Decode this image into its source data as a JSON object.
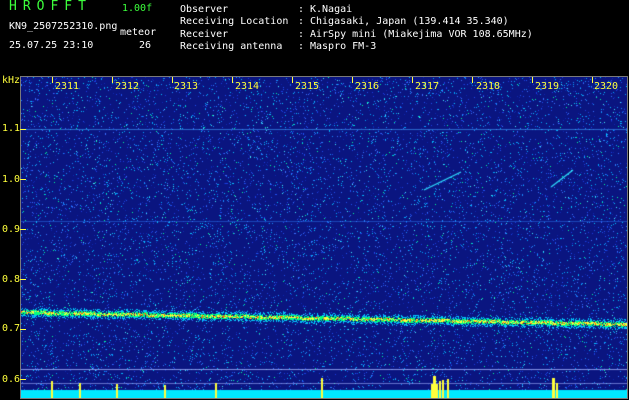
{
  "header": {
    "app_title": "HROFFT",
    "version": "1.00f",
    "file_name": "KN9_2507252310.png",
    "meteor_label": "meteor",
    "timestamp": "25.07.25 23:10",
    "meteor_count": "26"
  },
  "info": [
    {
      "label": "Observer",
      "value": "K.Nagai"
    },
    {
      "label": "Receiving Location",
      "value": "Chigasaki, Japan (139.414 35.340)"
    },
    {
      "label": "Receiver",
      "value": "AirSpy mini (Miakejima VOR 108.65MHz)"
    },
    {
      "label": "Receiving antenna",
      "value": "Maspro FM-3"
    }
  ],
  "spectrogram": {
    "y_unit": "kHz",
    "y_labels": [
      "1.1",
      "1.0",
      "0.9",
      "0.8",
      "0.7",
      "0.6"
    ],
    "time_labels": [
      "2311",
      "2312",
      "2313",
      "2314",
      "2315",
      "2316",
      "2317",
      "2318",
      "2319",
      "2320"
    ],
    "colors": {
      "background": "#0a1580",
      "trace": "#ffff3c",
      "noise_floor": "#00e8ff"
    }
  }
}
